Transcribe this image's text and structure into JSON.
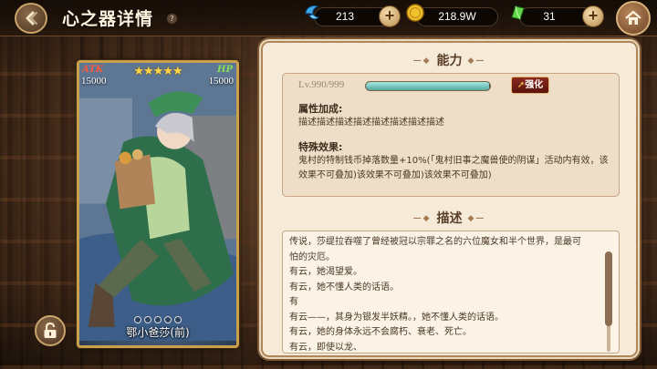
{
  "header": {
    "title": "心之器详情",
    "help_icon": "?"
  },
  "resources": [
    {
      "icon": "blue-crystal-icon",
      "value": "213"
    },
    {
      "icon": "gold-coin-icon",
      "value": "218.9W"
    },
    {
      "icon": "green-gem-icon",
      "value": "31"
    }
  ],
  "card": {
    "atk_label": "ATK",
    "hp_label": "HP",
    "atk": "15000",
    "hp": "15000",
    "stars": "★★★★★",
    "name": "鄂小爸莎(前)"
  },
  "ability": {
    "title": "能力",
    "level": "Lv.990/999",
    "level_progress": 0.99,
    "enhance_label": "强化",
    "attr_label": "属性加成:",
    "attr_text": "描述描述描述描述描述描述描述描述",
    "special_label": "特殊效果:",
    "special_lines": [
      "鬼村的特制钱币掉落数量+10%(「鬼村旧事之魔兽使的阴谋」活动内有效，该",
      "效果不可叠加)该效果不可叠加)该效果不可叠加)"
    ]
  },
  "description": {
    "title": "描述",
    "lines": [
      "传说，莎缇拉吞噬了曾经被冠以宗罪之名的六位魔女和半个世界，是最可",
      "怕的灾厄。",
      "有云，她渴望爱。",
      "有云，她不懂人类的话语。",
      "有",
      "有云——，其身为银发半妖精。，她不懂人类的话语。",
      "有云，她的身体永远不会腐朽、衰老、死亡。",
      "有云，即使以龙、"
    ]
  },
  "colors": {
    "panel_bg": "#f6ebd9",
    "accent_gold": "#c9a04b",
    "enhance_red": "#8a2a1e",
    "xp_teal": "#a7e8e2"
  }
}
